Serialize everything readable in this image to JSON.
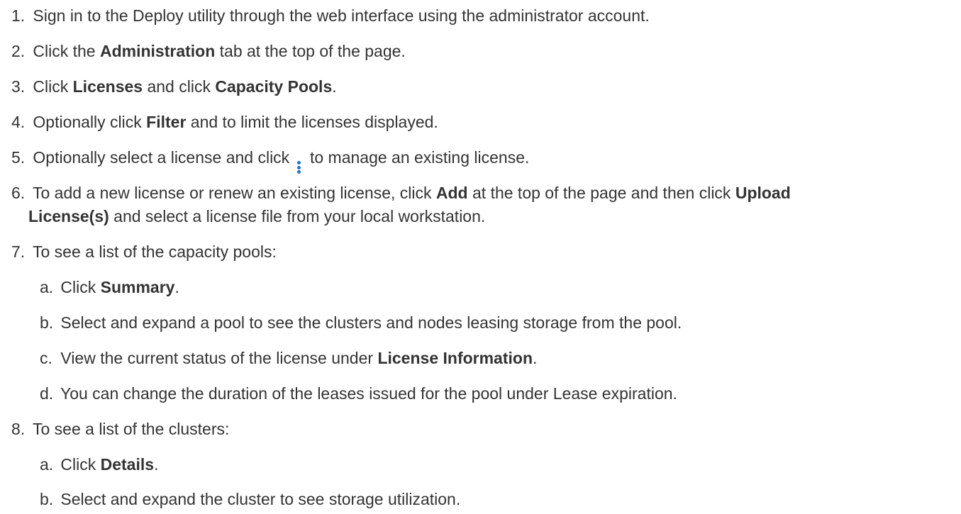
{
  "steps": [
    {
      "num": "1.",
      "parts": [
        "Sign in to the Deploy utility through the web interface using the administrator account."
      ]
    },
    {
      "num": "2.",
      "parts": [
        "Click the ",
        "Administration",
        " tab at the top of the page."
      ]
    },
    {
      "num": "3.",
      "parts": [
        "Click ",
        "Licenses",
        " and click ",
        "Capacity Pools",
        "."
      ]
    },
    {
      "num": "4.",
      "parts": [
        "Optionally click ",
        "Filter",
        " and to limit the licenses displayed."
      ]
    },
    {
      "num": "5.",
      "parts": [
        "Optionally select a license and click ",
        " to manage an existing license."
      ],
      "icon": "kebab-menu-icon",
      "icon_color": "#1e6fd9"
    },
    {
      "num": "6.",
      "line1": [
        "To add a new license or renew an existing license, click ",
        "Add",
        " at the top of the page and then click ",
        "Upload"
      ],
      "line2": [
        "License(s)",
        " and select a license file from your local workstation."
      ]
    },
    {
      "num": "7.",
      "parts": [
        "To see a list of the capacity pools:"
      ],
      "sub": [
        {
          "num": "a.",
          "parts": [
            "Click ",
            "Summary",
            "."
          ]
        },
        {
          "num": "b.",
          "parts": [
            "Select and expand a pool to see the clusters and nodes leasing storage from the pool."
          ]
        },
        {
          "num": "c.",
          "parts": [
            "View the current status of the license under ",
            "License Information",
            "."
          ]
        },
        {
          "num": "d.",
          "parts": [
            "You can change the duration of the leases issued for the pool under Lease expiration."
          ]
        }
      ]
    },
    {
      "num": "8.",
      "parts": [
        "To see a list of the clusters:"
      ],
      "sub": [
        {
          "num": "a.",
          "parts": [
            "Click ",
            "Details",
            "."
          ]
        },
        {
          "num": "b.",
          "parts": [
            "Select and expand the cluster to see storage utilization."
          ]
        }
      ]
    }
  ]
}
